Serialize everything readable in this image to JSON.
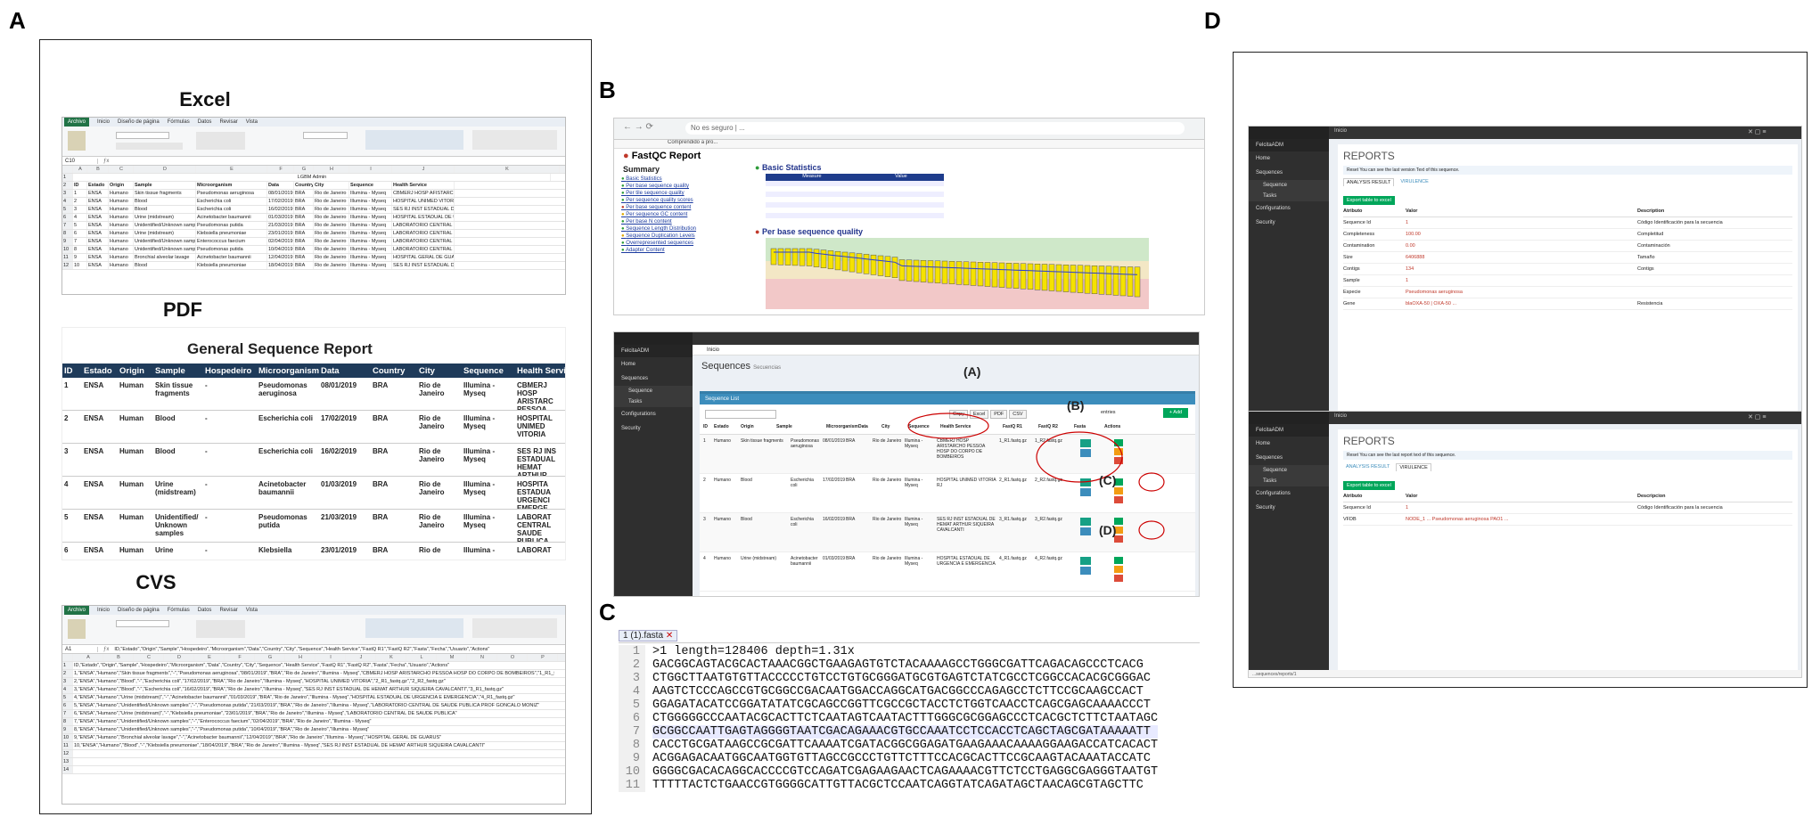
{
  "panels": {
    "a": "A",
    "b": "B",
    "c": "C",
    "d": "D"
  },
  "sections": {
    "excel": "Excel",
    "pdf": "PDF",
    "cvs": "CVS"
  },
  "excel": {
    "tabs": [
      "Archivo",
      "Inicio",
      "Diseño de página",
      "Fórmulas",
      "Datos",
      "Revisar",
      "Vista"
    ],
    "name_box": "C10",
    "banner": "LGBM Admin",
    "columns": [
      "ID",
      "Estado",
      "Origin",
      "Sample",
      "Microorganism",
      "Data",
      "Country",
      "City",
      "Sequence",
      "Health Service"
    ],
    "rows": [
      [
        "1",
        "ENSA",
        "Humano",
        "Skin tissue fragments",
        "Pseudomonas aeruginosa",
        "08/01/2019",
        "BRA",
        "Rio de Janeiro",
        "Illumina - Myseq",
        "CBMERJ HOSP AFISTARCHO PESSOA HOSP D"
      ],
      [
        "2",
        "ENSA",
        "Humano",
        "Blood",
        "Escherichia coli",
        "17/02/2019",
        "BRA",
        "Rio de Janeiro",
        "Illumina - Myseq",
        "HOSPITAL UNIMED VITORIA"
      ],
      [
        "3",
        "ENSA",
        "Humano",
        "Blood",
        "Escherichia coli",
        "16/02/2019",
        "BRA",
        "Rio de Janeiro",
        "Illumina - Myseq",
        "SES RJ INST ESTADUAL DE HEMATOLOGIA"
      ],
      [
        "4",
        "ENSA",
        "Humano",
        "Urine (midstream)",
        "Acinetobacter baumannii",
        "01/03/2019",
        "BRA",
        "Rio de Janeiro",
        "Illumina - Myseq",
        "HOSPITAL ESTADUAL DE URGENCIA"
      ],
      [
        "5",
        "ENSA",
        "Humano",
        "Unidentified/Unknown samples",
        "Pseudomonas putida",
        "21/03/2019",
        "BRA",
        "Rio de Janeiro",
        "Illumina - Myseq",
        "LABORATORIO CENTRAL DE SAUDE PUB"
      ],
      [
        "6",
        "ENSA",
        "Humano",
        "Urine (midstream)",
        "Klebsiella pneumoniae",
        "23/01/2019",
        "BRA",
        "Rio de Janeiro",
        "Illumina - Myseq",
        "LABORATORIO CENTRAL DE SAUDE PUB"
      ],
      [
        "7",
        "ENSA",
        "Humano",
        "Unidentified/Unknown samples",
        "Enterococcus faecium",
        "02/04/2019",
        "BRA",
        "Rio de Janeiro",
        "Illumina - Myseq",
        "LABORATORIO CENTRAL DE SAUDE PUB"
      ],
      [
        "8",
        "ENSA",
        "Humano",
        "Unidentified/Unknown samples",
        "Pseudomonas putida",
        "10/04/2019",
        "BRA",
        "Rio de Janeiro",
        "Illumina - Myseq",
        "LABORATORIO CENTRAL DE SAUDE PUB"
      ],
      [
        "9",
        "ENSA",
        "Humano",
        "Bronchial alveolar lavage",
        "Acinetobacter baumannii",
        "12/04/2019",
        "BRA",
        "Rio de Janeiro",
        "Illumina - Myseq",
        "HOSPITAL GERAL DE GUARUS"
      ],
      [
        "10",
        "ENSA",
        "Humano",
        "Blood",
        "Klebsiella pneumoniae",
        "18/04/2019",
        "BRA",
        "Rio de Janeiro",
        "Illumina - Myseq",
        "SES RJ INST ESTADUAL DE HEMATOLOGIA"
      ]
    ]
  },
  "pdf": {
    "title": "General Sequence Report",
    "columns": [
      "ID",
      "Estado",
      "Origin",
      "Sample",
      "Hospedeiro",
      "Microorganism",
      "Data",
      "Country",
      "City",
      "Sequence",
      "Health Servic"
    ],
    "rows": [
      [
        "1",
        "ENSA",
        "Human",
        "Skin tissue fragments",
        "-",
        "Pseudomonas aeruginosa",
        "08/01/2019",
        "BRA",
        "Rio de Janeiro",
        "Illumina - Myseq",
        "CBMERJ HOSP ARISTARC PESSOA HOSP DO CORPO DE BOMBEIR"
      ],
      [
        "2",
        "ENSA",
        "Human",
        "Blood",
        "-",
        "Escherichia coli",
        "17/02/2019",
        "BRA",
        "Rio de Janeiro",
        "Illumina - Myseq",
        "HOSPITAL UNIMED VITORIA"
      ],
      [
        "3",
        "ENSA",
        "Human",
        "Blood",
        "-",
        "Escherichia coli",
        "16/02/2019",
        "BRA",
        "Rio de Janeiro",
        "Illumina - Myseq",
        "SES RJ INS ESTADUAL HEMAT ARTHUR SIQUEIRA CAVALCA"
      ],
      [
        "4",
        "ENSA",
        "Human",
        "Urine (midstream)",
        "-",
        "Acinetobacter baumannii",
        "01/03/2019",
        "BRA",
        "Rio de Janeiro",
        "Illumina - Myseq",
        "HOSPITA ESTADUA URGENCI EMERGE"
      ],
      [
        "5",
        "ENSA",
        "Human",
        "Unidentified/ Unknown samples",
        "-",
        "Pseudomonas putida",
        "21/03/2019",
        "BRA",
        "Rio de Janeiro",
        "Illumina - Myseq",
        "LABORAT CENTRAL SAUDE PUBLICA PROF GONCALO"
      ],
      [
        "6",
        "ENSA",
        "Human",
        "Urine",
        "-",
        "Klebsiella",
        "23/01/2019",
        "BRA",
        "Rio de",
        "Illumina -",
        "LABORAT"
      ]
    ]
  },
  "csv": {
    "name_box": "A1",
    "formula": "ID,\"Estado\",\"Origin\",\"Sample\",\"Hospedeiro\",\"Microorganism\",\"Data\",\"Country\",\"City\",\"Sequence\",\"Health Service\",\"FastQ R1\",\"FastQ R2\",\"Fasta\",\"Fecha\",\"Usuario\",\"Actions\"",
    "columns": [
      "A",
      "B",
      "C",
      "D",
      "E",
      "F",
      "G",
      "H",
      "I",
      "J",
      "K",
      "L",
      "M",
      "N",
      "O",
      "P"
    ],
    "lines": [
      "ID,\"Estado\",\"Origin\",\"Sample\",\"Hospedeiro\",\"Microorganism\",\"Data\",\"Country\",\"City\",\"Sequence\",\"Health Service\",\"FastQ R1\",\"FastQ R2\",\"Fasta\",\"Fecha\",\"Usuario\",\"Actions\"",
      "1,\"ENSA\",\"Humano\",\"Skin tissue fragments\",\"-\",\"Pseudomonas aeruginosa\",\"08/01/2019\",\"BRA\",\"Rio de Janeiro\",\"Illumina - Myseq\",\"CBMERJ HOSP ARISTARCHO PESSOA HOSP DO CORPO DE BOMBEIROS\",\"1_R1_fastq.gz\"",
      "2,\"ENSA\",\"Humano\",\"Blood\",\"-\",\"Escherichia coli\",\"17/02/2019\",\"BRA\",\"Rio de Janeiro\",\"Illumina - Myseq\",\"HOSPITAL UNIMED VITORIA\",\"2_R1_fastq.gz\",\"2_R2_fastq.gz\"",
      "3,\"ENSA\",\"Humano\",\"Blood\",\"-\",\"Escherichia coli\",\"16/02/2019\",\"BRA\",\"Rio de Janeiro\",\"Illumina - Myseq\",\"SES RJ INST ESTADUAL DE HEMAT ARTHUR SIQUEIRA CAVALCANTI\",\"3_R1_fastq.gz\"",
      "4,\"ENSA\",\"Humano\",\"Urine (midstream)\",\"-\",\"Acinetobacter baumannii\",\"01/03/2019\",\"BRA\",\"Rio de Janeiro\",\"Illumina - Myseq\",\"HOSPITAL ESTADUAL DE URGENCIA E EMERGENCIA\",\"4_R1_fastq.gz\"",
      "5,\"ENSA\",\"Humano\",\"Unidentified/Unknown samples\",\"-\",\"Pseudomonas putida\",\"21/03/2019\",\"BRA\",\"Rio de Janeiro\",\"Illumina - Myseq\",\"LABORATORIO CENTRAL DE SAUDE PUBLICA PROF GONCALO MONIZ\"",
      "6,\"ENSA\",\"Humano\",\"Urine (midstream)\",\"-\",\"Klebsiella pneumoniae\",\"23/01/2019\",\"BRA\",\"Rio de Janeiro\",\"Illumina - Myseq\",\"LABORATORIO CENTRAL DE SAUDE PUBLICA\"",
      "7,\"ENSA\",\"Humano\",\"Unidentified/Unknown samples\",\"-\",\"Enterococcus faecium\",\"02/04/2019\",\"BRA\",\"Rio de Janeiro\",\"Illumina - Myseq\"",
      "8,\"ENSA\",\"Humano\",\"Unidentified/Unknown samples\",\"-\",\"Pseudomonas putida\",\"10/04/2019\",\"BRA\",\"Rio de Janeiro\",\"Illumina - Myseq\"",
      "9,\"ENSA\",\"Humano\",\"Bronchial alveolar lavage\",\"-\",\"Acinetobacter baumannii\",\"12/04/2019\",\"BRA\",\"Rio de Janeiro\",\"Illumina - Myseq\",\"HOSPITAL GERAL DE GUARUS\"",
      "10,\"ENSA\",\"Humano\",\"Blood\",\"-\",\"Klebsiella pneumoniae\",\"18/04/2019\",\"BRA\",\"Rio de Janeiro\",\"Illumina - Myseq\",\"SES RJ INST ESTADUAL DE HEMAT ARTHUR SIQUEIRA CAVALCANTI\""
    ]
  },
  "fastqc": {
    "tab": "Comprendido a pro...",
    "address": "No es seguro | ...",
    "title": "FastQC Report",
    "summary": "Summary",
    "summary_items": [
      "Basic Statistics",
      "Per base sequence quality",
      "Per tile sequence quality",
      "Per sequence quality scores",
      "Per base sequence content",
      "Per sequence GC content",
      "Per base N content",
      "Sequence Length Distribution",
      "Sequence Duplication Levels",
      "Overrepresented sequences",
      "Adapter Content"
    ],
    "basic_stats": "Basic Statistics",
    "stats_header": [
      "Measure",
      "Value"
    ],
    "quality_title": "Per base sequence quality"
  },
  "seqlist": {
    "user": "FelcitaADM",
    "breadcrumb": "Inicio",
    "page_title": "Sequences",
    "page_sub": "Secuencias",
    "nav": [
      "Home",
      "Sequences",
      "Sequence",
      "Tasks",
      "Configurations",
      "Security"
    ],
    "box_title": "Sequence List",
    "export_buttons": [
      "Copy",
      "Excel",
      "PDF",
      "CSV"
    ],
    "add_button": "+ Add",
    "entries": "entries",
    "columns": [
      "ID",
      "Estado",
      "Origin",
      "Sample",
      "Microorganism",
      "Data",
      "City",
      "Sequence",
      "Health Service",
      "FastQ R1",
      "FastQ R2",
      "Fasta",
      "Actions"
    ],
    "rows": [
      [
        "1",
        "Humano",
        "Skin tissue fragments",
        "Pseudomonas aeruginosa",
        "08/01/2019",
        "BRA",
        "Rio de Janeiro",
        "Illumina - Myseq",
        "CBMERJ HOSP ARISTARCHO PESSOA HOSP DO CORPO DE BOMBEIROS",
        "1_R1.fastq.gz",
        "1_R2.fastq.gz"
      ],
      [
        "2",
        "Humano",
        "Blood",
        "Escherichia coli",
        "17/02/2019",
        "BRA",
        "Rio de Janeiro",
        "Illumina - Myseq",
        "HOSPITAL UNIMED VITORIA RJ",
        "2_R1.fastq.gz",
        "2_R2.fastq.gz"
      ],
      [
        "3",
        "Humano",
        "Blood",
        "Escherichia coli",
        "16/02/2019",
        "BRA",
        "Rio de Janeiro",
        "Illumina - Myseq",
        "SES RJ INST ESTADUAL DE HEMAT ARTHUR SIQUEIRA CAVALCANTI",
        "3_R1.fastq.gz",
        "3_R2.fastq.gz"
      ],
      [
        "4",
        "Humano",
        "Urine (midstream)",
        "Acinetobacter baumannii",
        "01/03/2019",
        "BRA",
        "Rio de Janeiro",
        "Illumina - Myseq",
        "HOSPITAL ESTADUAL DE URGENCIA E EMERGENCIA",
        "4_R1.fastq.gz",
        "4_R2.fastq.gz"
      ]
    ],
    "callouts": {
      "a": "(A)",
      "b": "(B)",
      "c": "(C)",
      "d": "(D)"
    }
  },
  "fasta": {
    "tab": "1 (1).fasta",
    "header": ">1 length=128406 depth=1.31x",
    "lines": [
      "GACGGCAGTACGCACTAAACGGCTGAAGAGTGTCTACAAAAGCCTGGGCGATTCAGACAGCCCTCACG",
      "CTGGCTTAATGTGTTACCCCCTGTCCTGTGCGGGATGCGTGAGTCTATCGCCTCGGCCACACGCGGGAC",
      "AAGTCTCCCAGCCGTGCGGCCGACAATGGACCAGGCATGACGGCCCAGAGCCTCTTCCGCAAGCCACT",
      "GGAGATACATCCGGATATATCGCAGCCGGTTCGCCGCTACCTCTGGTCAACCTCAGCGAGCAAAACCCT",
      "CTGGGGGCCCAATACGCACTTCTCAATAGTCAATACTTTGGGCGCGGAGCCCTCACGCTCTTCTAATAGC",
      "GCGGCCAATTGAGTAGGGGTAATCGACAGAAACGTGCCAAATCCTCCACCTCAGCTAGCGATAAAAATT",
      "CACCTGCGATAAGCCGCGATTCAAAATCGATACGGCGGAGATGAAGAAACAAAAGGAAGACCATCACACT",
      "ACGGAGACAATGGCAATGGTGTTAGCCGCCCTGTTCTTTCCACGCACTTCCGCAAGTACAAATACCATC",
      "GGGGCGACACAGGCACCCCGTCCAGATCGAGAAGAACTCAGAAAACGTTCTCCTGAGGCGAGGGTAATGT",
      "TTTTTACTCTGAACCGTGGGGCATTGTTACGCTCCAATCAGGTATCAGATAGCTAACAGCGTAGCTTC"
    ]
  },
  "reports": {
    "user": "FelcitaADM",
    "breadcrumb": "Inicio",
    "nav": [
      "Home",
      "Sequences",
      "Sequence",
      "Tasks",
      "Configurations",
      "Security"
    ],
    "title": "REPORTS",
    "notice1": "Reset You can see the last version Text of this sequence.",
    "notice2": "Reset You can see the last report text of this sequence.",
    "tabs": [
      "ANALYSIS RESULT",
      "VIRULENCE"
    ],
    "export": "Export table to excel",
    "columns": [
      "Atributo",
      "Valor",
      "Description"
    ],
    "rows": [
      [
        "Sequence Id",
        "1",
        "Código Identificación para la secuencia"
      ],
      [
        "Completeness",
        "100.00",
        "Completitud"
      ],
      [
        "Contamination",
        "0.00",
        "Contaminación"
      ],
      [
        "Size",
        "6406888",
        "Tamaño"
      ],
      [
        "Contigs",
        "134",
        "Contigs"
      ],
      [
        "Sample",
        "1",
        ""
      ],
      [
        "Especie",
        "Pseudomonas aeruginosa",
        ""
      ],
      [
        "Gene",
        "blaOXA-50 | OXA-50 ...",
        "Resistencia"
      ]
    ],
    "vir_columns": [
      "Atributo",
      "Valor",
      "Descripcion"
    ],
    "vir_rows": [
      [
        "Sequence Id",
        "1",
        "Código Identificación para la secuencia"
      ],
      [
        "VFDB",
        "NODE_1 ... Pseudomonas aeruginosa PAO1 ...",
        ""
      ]
    ],
    "status_url": "...sequences/reports/1"
  },
  "colors": {
    "excel_green": "#217346",
    "pdf_header": "#1f3b5a",
    "adminlte_dark": "#2f2f2f",
    "teal": "#16a085",
    "red_annot": "#cc0000"
  }
}
